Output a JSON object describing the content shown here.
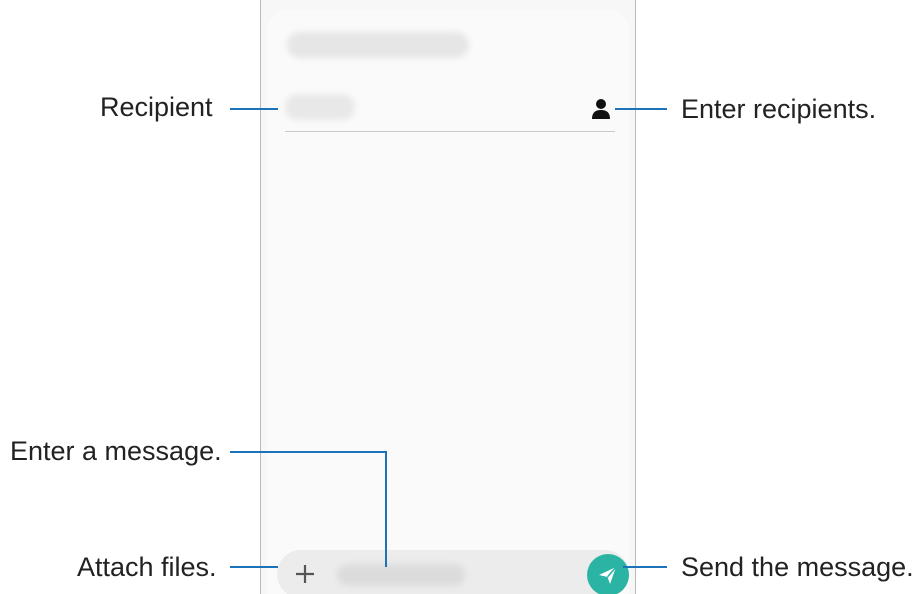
{
  "callouts": {
    "recipient": "Recipient",
    "enter_recipients": "Enter recipients.",
    "enter_message": "Enter a message.",
    "attach_files": "Attach files.",
    "send_message": "Send the message."
  },
  "icons": {
    "contact": "person-icon",
    "attach": "plus-icon",
    "send": "paper-plane-icon"
  },
  "colors": {
    "callout_line": "#1c73b8",
    "send_button": "#2bb3a3"
  }
}
